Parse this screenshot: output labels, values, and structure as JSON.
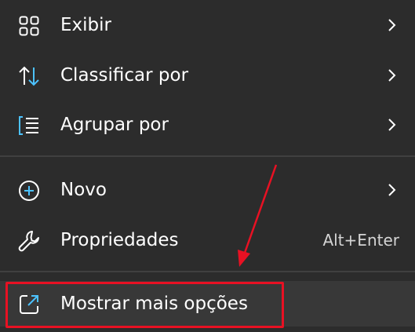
{
  "menu": {
    "items": [
      {
        "label": "Exibir",
        "icon": "grid-view-icon",
        "has_submenu": true
      },
      {
        "label": "Classificar por",
        "icon": "sort-arrows-icon",
        "has_submenu": true
      },
      {
        "label": "Agrupar por",
        "icon": "group-list-icon",
        "has_submenu": true
      },
      {
        "label": "Novo",
        "icon": "plus-circle-icon",
        "has_submenu": true
      },
      {
        "label": "Propriedades",
        "icon": "wrench-icon",
        "shortcut": "Alt+Enter"
      },
      {
        "label": "Mostrar mais opções",
        "icon": "open-external-icon"
      }
    ]
  },
  "annotation": {
    "color": "#e81123"
  },
  "colors": {
    "background": "#2c2c2c",
    "icon_blue": "#4cc2ff",
    "text": "#ffffff",
    "divider": "#404040"
  }
}
